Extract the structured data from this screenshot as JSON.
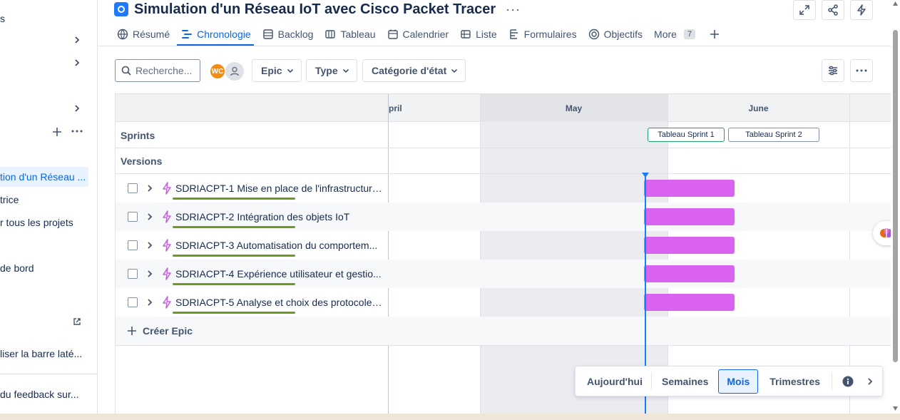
{
  "sidebar": {
    "items": [
      {
        "label": "s",
        "chevron": false
      },
      {
        "label": "",
        "chevron": true
      },
      {
        "label": "",
        "chevron": true
      },
      {
        "label": "",
        "chevron": true
      },
      {
        "label": "tion d'un Réseau ...",
        "selected": true
      },
      {
        "label": "trice"
      },
      {
        "label": "r tous les projets"
      },
      {
        "label": "de bord"
      },
      {
        "label": "liser la barre laté..."
      },
      {
        "label": "du feedback sur..."
      }
    ]
  },
  "header": {
    "title": "Simulation d'un Réseau IoT avec Cisco Packet Tracer",
    "more": "···"
  },
  "tabs": [
    {
      "label": "Résumé",
      "icon": "globe-icon"
    },
    {
      "label": "Chronologie",
      "icon": "timeline-icon",
      "active": true
    },
    {
      "label": "Backlog",
      "icon": "backlog-icon"
    },
    {
      "label": "Tableau",
      "icon": "board-icon"
    },
    {
      "label": "Calendrier",
      "icon": "calendar-icon"
    },
    {
      "label": "Liste",
      "icon": "list-icon"
    },
    {
      "label": "Formulaires",
      "icon": "forms-icon"
    },
    {
      "label": "Objectifs",
      "icon": "target-icon"
    },
    {
      "label": "More",
      "count": "7"
    }
  ],
  "toolbar": {
    "search_placeholder": "Recherche...",
    "avatar_initials": "WC",
    "filters": [
      "Epic",
      "Type",
      "Catégorie d'état"
    ]
  },
  "timeline": {
    "months": [
      "pril",
      "May",
      "June"
    ],
    "lanes": [
      "Sprints",
      "Versions"
    ],
    "sprints": [
      "Tableau Sprint 1",
      "Tableau Sprint 2"
    ],
    "epics": [
      {
        "key": "SDRIACPT-1",
        "title": "Mise en place de l'infrastructure..."
      },
      {
        "key": "SDRIACPT-2",
        "title": "Intégration des objets IoT"
      },
      {
        "key": "SDRIACPT-3",
        "title": "Automatisation du comportem..."
      },
      {
        "key": "SDRIACPT-4",
        "title": "Expérience utilisateur et gestio..."
      },
      {
        "key": "SDRIACPT-5",
        "title": "Analyse et choix des protocoles..."
      }
    ],
    "create_epic": "Créer Epic"
  },
  "zoom": {
    "today": "Aujourd'hui",
    "options": [
      "Semaines",
      "Mois",
      "Trimestres"
    ],
    "active": "Mois"
  },
  "colors": {
    "accent": "#0c66e4",
    "epic_bar": "#da62f0",
    "progress": "#6a9a23",
    "today_line": "#1d7afc"
  }
}
